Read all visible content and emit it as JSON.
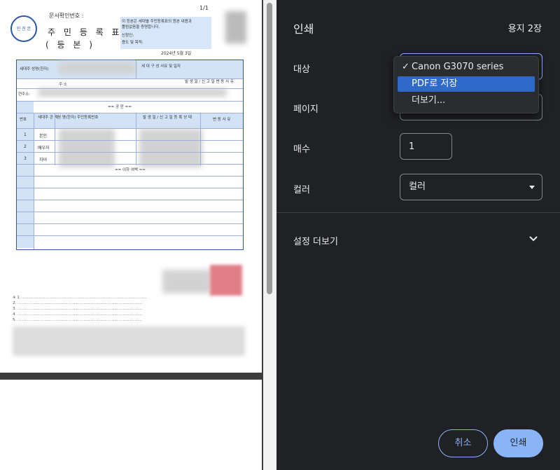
{
  "dialog": {
    "title": "인쇄",
    "sheet_count": "용지 2장"
  },
  "destination": {
    "label": "대상",
    "options": [
      {
        "label": "Canon G3070 series",
        "checked": true
      },
      {
        "label": "PDF로 저장",
        "highlighted": true
      },
      {
        "label": "더보기..."
      }
    ],
    "check_mark": "✓"
  },
  "pages": {
    "label": "페이지"
  },
  "copies": {
    "label": "매수",
    "value": "1"
  },
  "color": {
    "label": "컬러",
    "value": "컬러"
  },
  "more_settings": {
    "label": "설정 더보기"
  },
  "buttons": {
    "cancel": "취소",
    "print": "인쇄"
  },
  "preview": {
    "doc_title": "주 민 등 록 표",
    "doc_subtitle": "( 등          본 )",
    "doc_number_label": "문서확인번호 :",
    "page_indicator": "1/1",
    "seal_text": "인 진 본",
    "header_note_1": "이 등본은 세대별 주민등록표의 원본 내용과",
    "header_note_2": "틀림없음을 증명합니다.",
    "issue_date": "2024년 5월 3일",
    "field_applicant": "신청인:",
    "field_purpose": "용도 및 목적:",
    "col_household_head": "세대주 성명(한자)",
    "col_household_reason": "세 대 구 성\n사유 및 일자",
    "col_address": "주          소",
    "col_change_date": "발 생 일 / 신 고 일\n변      동     사     유",
    "row_previous_address": "현주소:",
    "row_blank": "==  공  란  ==",
    "col_number": "번호",
    "col_relation": "세대주\n관 계",
    "col_name": "성  명(한자)\n주민등록번호",
    "col_report_date": "발 생 일 / 신 고 일\n등 록 상 태",
    "col_change_reason": "변 동 사 유",
    "rows": [
      {
        "num": "1",
        "relation": "본인"
      },
      {
        "num": "2",
        "relation": "배우자"
      },
      {
        "num": "3",
        "relation": "자녀"
      }
    ],
    "end_text": "== 이하 여백 =="
  }
}
